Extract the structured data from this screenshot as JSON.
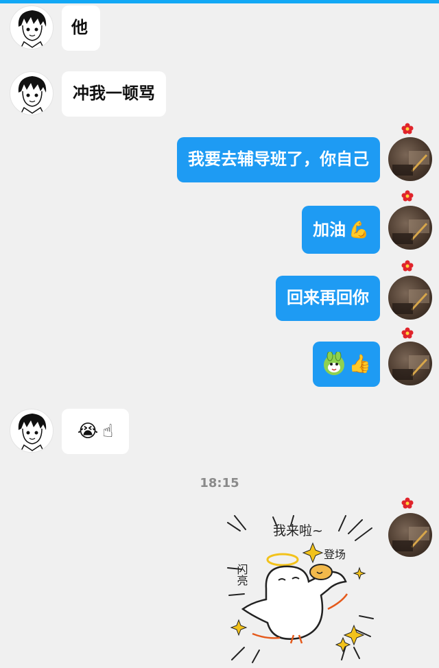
{
  "messages": [
    {
      "side": "in",
      "text": "他"
    },
    {
      "side": "in",
      "text": "冲我一顿骂"
    },
    {
      "side": "out",
      "text": "我要去辅导班了，你自己"
    },
    {
      "side": "out",
      "text": "加油",
      "emoji": "💪"
    },
    {
      "side": "out",
      "text": "回来再回你"
    },
    {
      "side": "out",
      "emoji_pair": "bunny-sticker-icon",
      "emoji": "👍"
    },
    {
      "side": "in",
      "emoji_pair": "😭",
      "emoji": "☝"
    }
  ],
  "timestamp": "18:15",
  "sticker": {
    "text_top": "我来啦~",
    "text_left": "闪亮",
    "text_right": "登场"
  },
  "colors": {
    "accent": "#1e9bf3",
    "incoming": "#ffffff",
    "background": "#f0f0f0"
  }
}
